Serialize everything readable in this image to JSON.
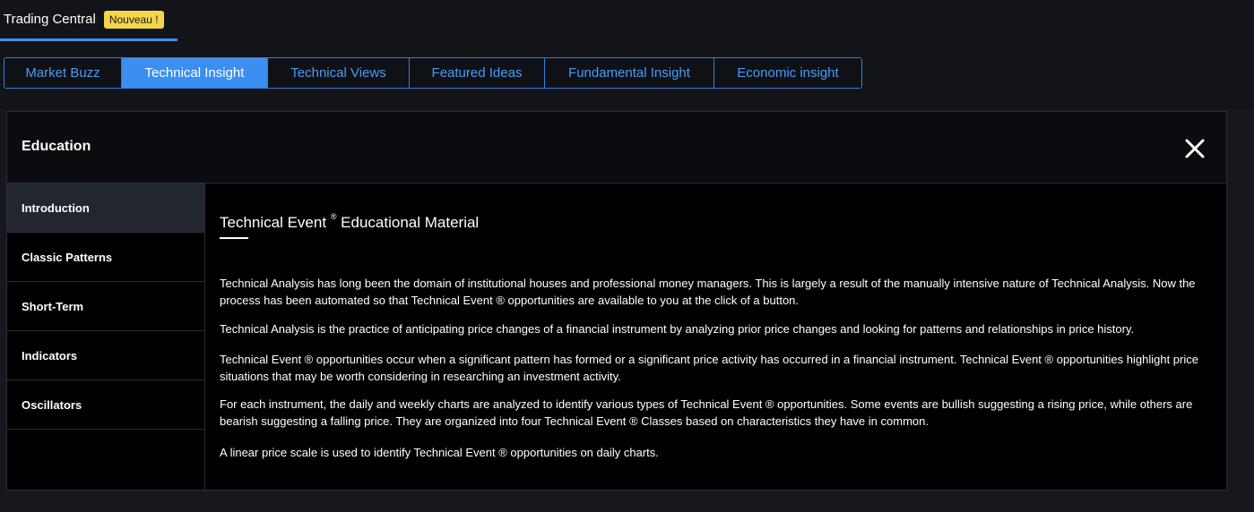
{
  "header": {
    "brand_title": "Trading Central",
    "badge": "Nouveau !"
  },
  "tabs": [
    {
      "label": "Market Buzz",
      "active": false
    },
    {
      "label": "Technical Insight",
      "active": true
    },
    {
      "label": "Technical Views",
      "active": false
    },
    {
      "label": "Featured Ideas",
      "active": false
    },
    {
      "label": "Fundamental Insight",
      "active": false
    },
    {
      "label": "Economic insight",
      "active": false
    }
  ],
  "panel": {
    "title": "Education",
    "close_icon": "close-icon"
  },
  "sidebar": {
    "items": [
      {
        "label": "Introduction",
        "active": true
      },
      {
        "label": "Classic Patterns",
        "active": false
      },
      {
        "label": "Short-Term",
        "active": false
      },
      {
        "label": "Indicators",
        "active": false
      },
      {
        "label": "Oscillators",
        "active": false
      }
    ]
  },
  "content": {
    "title_pre": "Technical Event",
    "title_mark": "®",
    "title_post": " Educational Material",
    "paragraphs": [
      "Technical Analysis has long been the domain of institutional houses and professional money managers. This is largely a result of the manually intensive nature of Technical Analysis. Now the process has been automated so that Technical Event ® opportunities are available to you at the click of a button.",
      "Technical Analysis is the practice of anticipating price changes of a financial instrument by analyzing prior price changes and looking for patterns and relationships in price history.",
      "Technical Event ® opportunities occur when a significant pattern has formed or a significant price activity has occurred in a financial instrument. Technical Event ® opportunities highlight price situations that may be worth considering in researching an investment activity.",
      "For each instrument, the daily and weekly charts are analyzed to identify various types of Technical Event ® opportunities. Some events are bullish suggesting a rising price, while others are bearish suggesting a falling price. They are organized into four Technical Event ® Classes based on characteristics they have in common.",
      "A linear price scale is used to identify Technical Event ® opportunities on daily charts."
    ]
  },
  "colors": {
    "accent": "#3a8ff0",
    "badge": "#f5d54a",
    "background": "#000000"
  }
}
